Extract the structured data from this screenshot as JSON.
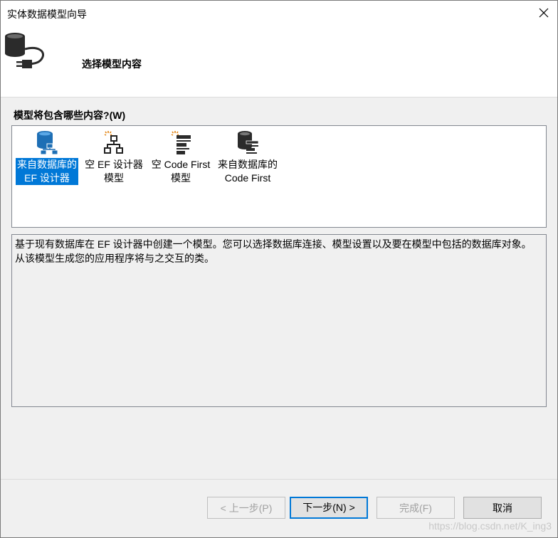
{
  "window": {
    "title": "实体数据模型向导",
    "close_icon": "close-icon"
  },
  "header": {
    "title": "选择模型内容",
    "icon": "database-plug-icon"
  },
  "section": {
    "label": "模型将包含哪些内容?",
    "accelerator": "(W)"
  },
  "model_options": [
    {
      "label": "来自数据库的\nEF 设计器",
      "icon": "database-diagram-icon",
      "selected": true
    },
    {
      "label": "空 EF 设计器\n模型",
      "icon": "empty-diagram-icon",
      "selected": false
    },
    {
      "label": "空 Code First\n模型",
      "icon": "empty-code-first-icon",
      "selected": false
    },
    {
      "label": "来自数据库的\nCode First",
      "icon": "database-code-first-icon",
      "selected": false
    }
  ],
  "description": "基于现有数据库在 EF 设计器中创建一个模型。您可以选择数据库连接、模型设置以及要在模型中包括的数据库对象。从该模型生成您的应用程序将与之交互的类。",
  "buttons": {
    "back": "< 上一步(P)",
    "next": "下一步(N) >",
    "finish": "完成(F)",
    "cancel": "取消"
  },
  "watermark": "https://blog.csdn.net/K_ing3",
  "colors": {
    "selection": "#0078d7",
    "default_button_border": "#0078d7",
    "dialog_background": "#f0f0f0"
  }
}
